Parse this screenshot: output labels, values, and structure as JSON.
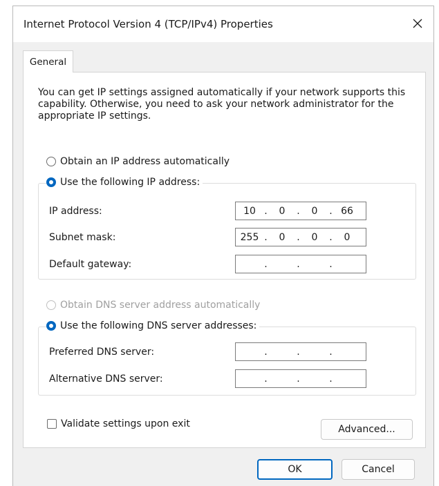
{
  "window": {
    "title": "Internet Protocol Version 4 (TCP/IPv4) Properties",
    "close_icon": "close-icon"
  },
  "tabs": [
    {
      "label": "General",
      "selected": true
    }
  ],
  "description": "You can get IP settings assigned automatically if your network supports this capability. Otherwise, you need to ask your network administrator for the appropriate IP settings.",
  "ip_mode": {
    "auto_label": "Obtain an IP address automatically",
    "manual_label": "Use the following IP address:",
    "selected": "manual"
  },
  "ip_fields": {
    "ip_address": {
      "label": "IP address:",
      "octets": [
        "10",
        "0",
        "0",
        "66"
      ]
    },
    "subnet_mask": {
      "label": "Subnet mask:",
      "octets": [
        "255",
        "0",
        "0",
        "0"
      ]
    },
    "default_gateway": {
      "label": "Default gateway:",
      "octets": [
        "",
        "",
        "",
        ""
      ]
    }
  },
  "dns_mode": {
    "auto_label": "Obtain DNS server address automatically",
    "manual_label": "Use the following DNS server addresses:",
    "selected": "manual",
    "auto_disabled": true
  },
  "dns_fields": {
    "preferred": {
      "label": "Preferred DNS server:",
      "octets": [
        "",
        "",
        "",
        ""
      ]
    },
    "alternative": {
      "label": "Alternative DNS server:",
      "octets": [
        "",
        "",
        "",
        ""
      ]
    }
  },
  "validate": {
    "label": "Validate settings upon exit",
    "checked": false
  },
  "buttons": {
    "advanced": "Advanced...",
    "ok": "OK",
    "cancel": "Cancel"
  },
  "colors": {
    "accent": "#0067c0",
    "dialog_bg": "#f0f0f0",
    "panel_bg": "#ffffff"
  }
}
